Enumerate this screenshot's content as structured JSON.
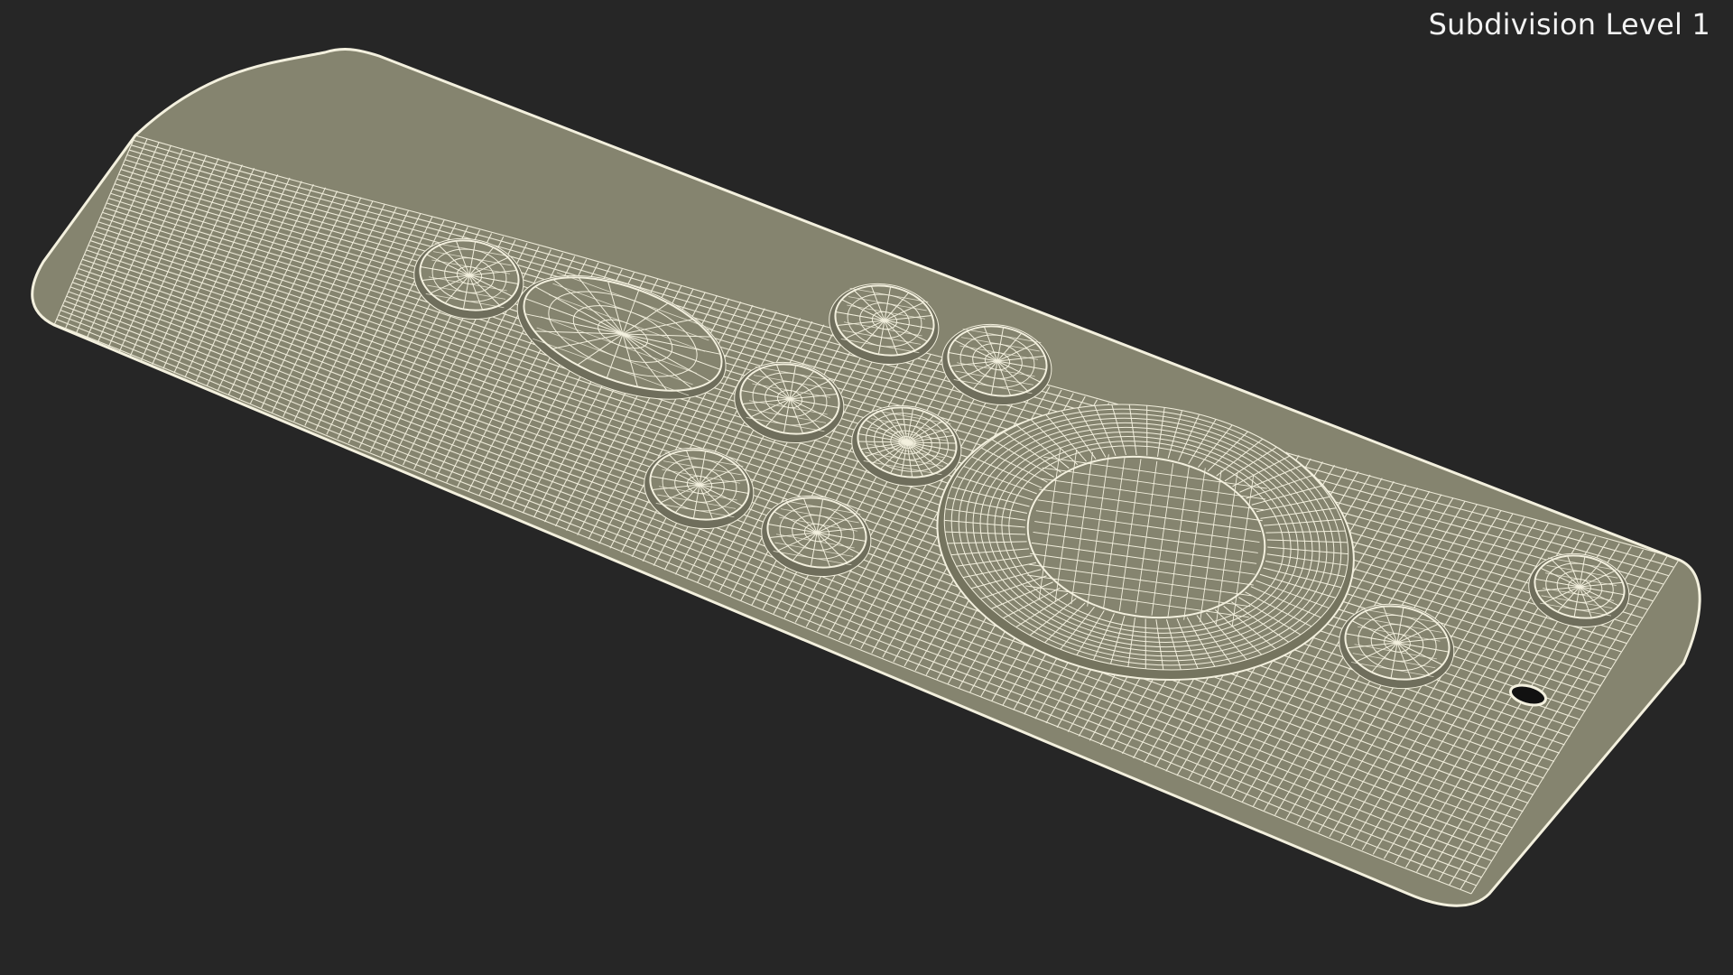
{
  "viewport": {
    "subdivision_label": "Subdivision Level 1",
    "background_color": "#262626",
    "surface_color": "#85846f",
    "wire_color": "#f3f0de"
  },
  "model": {
    "object": "remote-control-wireframe",
    "icons": [
      "button-icon",
      "pill-button-icon",
      "dpad-ring-icon",
      "dpad-center-icon",
      "lanyard-hole-icon"
    ]
  }
}
